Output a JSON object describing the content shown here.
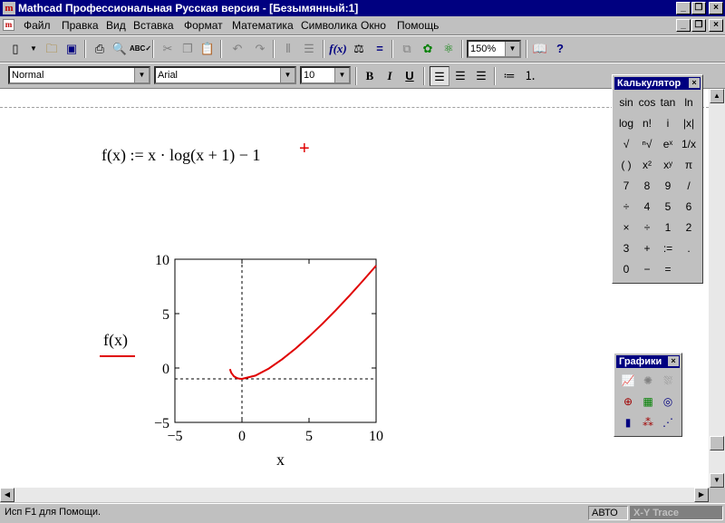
{
  "window": {
    "title": "Mathcad Профессиональная Русская версия - [Безымянный:1]"
  },
  "menu": [
    "Файл",
    "Правка",
    "Вид",
    "Вставка",
    "Формат",
    "Математика",
    "Символика",
    "Окно",
    "Помощь"
  ],
  "toolbar": {
    "zoom": "150%"
  },
  "format_toolbar": {
    "style": "Normal",
    "font": "Arial",
    "size": "10",
    "bold": "B",
    "italic": "I",
    "underline": "U"
  },
  "worksheet": {
    "equation": "f(x) := x · log(x + 1) − 1",
    "plot": {
      "y_label": "f(x)",
      "x_label": "x",
      "y_ticks": [
        "10",
        "5",
        "0",
        "−5"
      ],
      "x_ticks": [
        "−5",
        "0",
        "5",
        "10"
      ]
    }
  },
  "chart_data": {
    "type": "line",
    "series": [
      {
        "name": "f(x)",
        "color": "#e00000",
        "function": "x·log(x+1) − 1"
      }
    ],
    "xlim": [
      -5,
      10
    ],
    "ylim": [
      -5,
      10
    ],
    "xlabel": "x",
    "ylabel": "f(x)",
    "x": [
      -0.9,
      -0.8,
      -0.6,
      -0.4,
      -0.2,
      0,
      1,
      2,
      3,
      4,
      5,
      6,
      7,
      8,
      9,
      10
    ],
    "y": [
      -0.1,
      -0.44,
      -0.76,
      -0.91,
      -0.98,
      -1.0,
      -0.7,
      -0.05,
      0.81,
      1.79,
      2.89,
      4.07,
      5.32,
      6.63,
      8.0,
      9.41
    ],
    "reference_lines": {
      "vertical_x": 0,
      "horizontal_y": -1
    }
  },
  "calculator": {
    "title": "Калькулятор",
    "keys": [
      "sin",
      "cos",
      "tan",
      "ln",
      "log",
      "n!",
      "i",
      "|x|",
      "√",
      "ⁿ√",
      "eˣ",
      "1/x",
      "( )",
      "x²",
      "xʸ",
      "π",
      "7",
      "8",
      "9",
      "/",
      "÷",
      "4",
      "5",
      "6",
      "×",
      "÷",
      "1",
      "2",
      "3",
      "+",
      ":=",
      ".",
      "0",
      "−",
      "="
    ]
  },
  "graphs": {
    "title": "Графики"
  },
  "status": {
    "help": "Исп F1 для Помощи.",
    "mode": "АВТО",
    "trace": "X-Y Trace"
  }
}
